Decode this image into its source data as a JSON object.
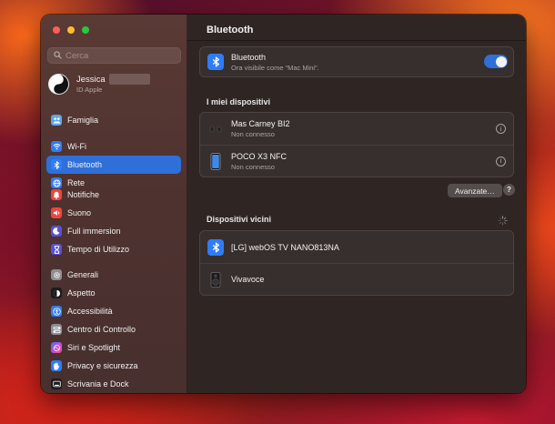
{
  "sidebar": {
    "search_placeholder": "Cerca",
    "profile": {
      "name": "Jessica",
      "subtitle": "ID Apple"
    },
    "groups": [
      {
        "items": [
          {
            "label": "Famiglia",
            "icon": "family-icon",
            "color": "#5aa7e8"
          }
        ]
      },
      {
        "items": [
          {
            "label": "Wi-Fi",
            "icon": "wifi-icon",
            "color": "#2f7cf6"
          },
          {
            "label": "Bluetooth",
            "icon": "bluetooth-icon",
            "color": "#2f7cf6",
            "selected": true
          },
          {
            "label": "Rete",
            "icon": "network-icon",
            "color": "#2f7cf6"
          }
        ]
      },
      {
        "items": [
          {
            "label": "Notifiche",
            "icon": "notifications-icon",
            "color": "#f0453a"
          },
          {
            "label": "Suono",
            "icon": "sound-icon",
            "color": "#f0453a"
          },
          {
            "label": "Full immersion",
            "icon": "focus-icon",
            "color": "#5b4fd6"
          },
          {
            "label": "Tempo di Utilizzo",
            "icon": "screen-time-icon",
            "color": "#5b4fd6"
          }
        ]
      },
      {
        "items": [
          {
            "label": "Generali",
            "icon": "gear-icon",
            "color": "#8e8e93"
          },
          {
            "label": "Aspetto",
            "icon": "appearance-icon",
            "color": "#1c1c1e"
          },
          {
            "label": "Accessibilità",
            "icon": "accessibility-icon",
            "color": "#2f7cf6"
          },
          {
            "label": "Centro di Controllo",
            "icon": "control-center-icon",
            "color": "#8e8e93"
          },
          {
            "label": "Siri e Spotlight",
            "icon": "siri-icon",
            "color": "#c34de0"
          },
          {
            "label": "Privacy e sicurezza",
            "icon": "privacy-hand-icon",
            "color": "#2f7cf6"
          },
          {
            "label": "Scrivania e Dock",
            "icon": "desktop-dock-icon",
            "color": "#1c1c1e"
          }
        ]
      }
    ]
  },
  "content": {
    "title": "Bluetooth",
    "bluetooth_row": {
      "title": "Bluetooth",
      "subtitle": "Ora visibile come “Mac Mini”.",
      "enabled": true
    },
    "my_devices_label": "I miei dispositivi",
    "my_devices": [
      {
        "name": "Mas Carney BI2",
        "status": "Non connesso",
        "icon": "earbuds-icon"
      },
      {
        "name": "POCO X3 NFC",
        "status": "Non connesso",
        "icon": "phone-icon"
      }
    ],
    "advanced_button": "Avanzate…",
    "help_button": "?",
    "nearby_label": "Dispositivi vicini",
    "nearby_devices": [
      {
        "name": "[LG] webOS TV NANO813NA",
        "icon": "bluetooth-icon"
      },
      {
        "name": "Vivavoce",
        "icon": "speaker-icon"
      }
    ]
  }
}
